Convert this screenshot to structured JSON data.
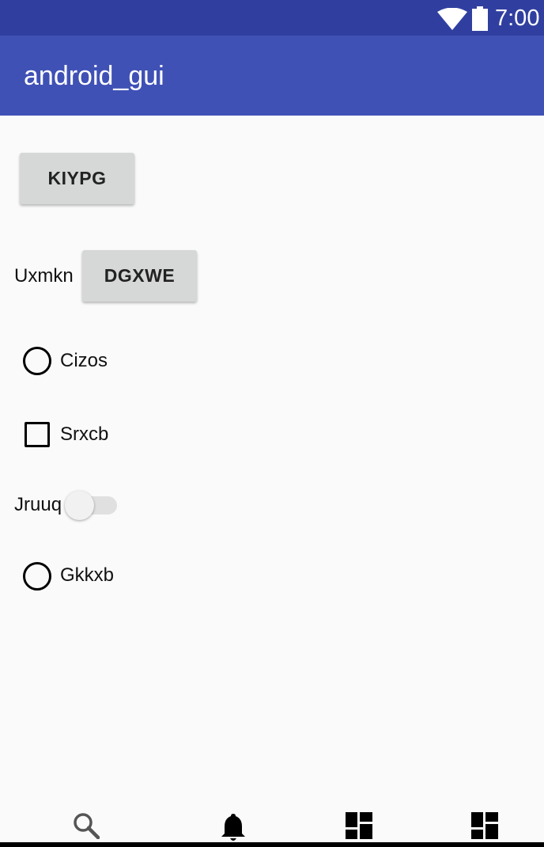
{
  "status_bar": {
    "time": "7:00",
    "icons": [
      "wifi-icon",
      "battery-icon"
    ],
    "color": "#303f9f"
  },
  "app_bar": {
    "title": "android_gui",
    "color": "#3f51b5"
  },
  "controls": {
    "button1": {
      "label": "KIYPG"
    },
    "row2": {
      "label": "Uxmkn",
      "button_label": "DGXWE"
    },
    "radio1": {
      "label": "Cizos",
      "checked": false
    },
    "checkbox1": {
      "label": "Srxcb",
      "checked": false
    },
    "switch1": {
      "label": "Jruuq",
      "on": false
    },
    "radio2": {
      "label": "Gkkxb",
      "checked": false
    }
  },
  "bottom_nav": {
    "items": [
      "search-icon",
      "notification-bell-icon",
      "dashboard-icon",
      "dashboard-icon"
    ]
  }
}
